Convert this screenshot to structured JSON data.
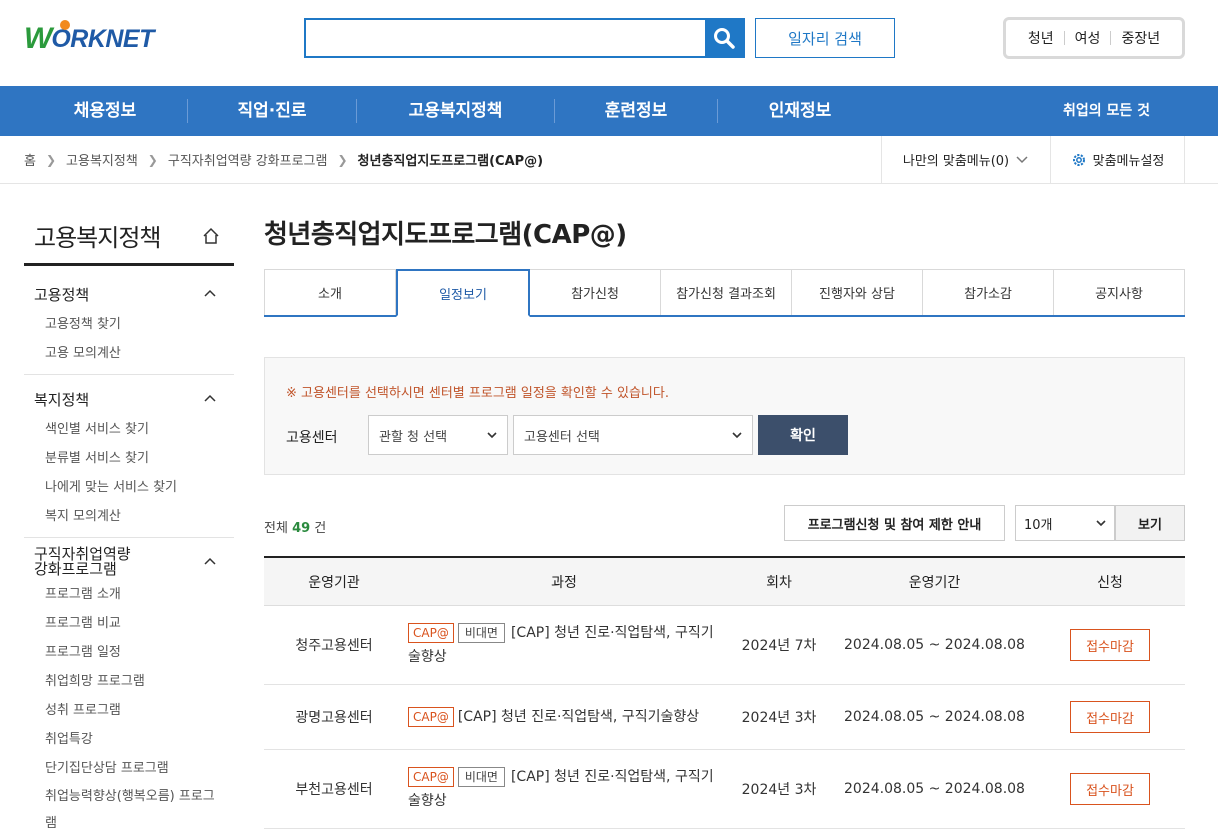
{
  "header": {
    "logo_text": "WORKNET",
    "search_placeholder": "",
    "job_search_label": "일자리 검색",
    "segments": [
      "청년",
      "여성",
      "중장년"
    ]
  },
  "gnb": {
    "items": [
      "채용정보",
      "직업·진로",
      "고용복지정책",
      "훈련정보",
      "인재정보"
    ],
    "all_label": "취업의 모든 것"
  },
  "breadcrumb": {
    "items": [
      "홈",
      "고용복지정책",
      "구직자취업역량 강화프로그램",
      "청년층직업지도프로그램(CAP@)"
    ],
    "my_menu": "나만의 맞춤메뉴(0)",
    "setting": "맞춤메뉴설정"
  },
  "sidebar": {
    "title": "고용복지정책",
    "groups": [
      {
        "title": "고용정책",
        "items": [
          "고용정책 찾기",
          "고용 모의계산"
        ]
      },
      {
        "title": "복지정책",
        "items": [
          "색인별 서비스 찾기",
          "분류별 서비스 찾기",
          "나에게 맞는 서비스 찾기",
          "복지 모의계산"
        ]
      },
      {
        "title_line1": "구직자취업역량",
        "title_line2": "강화프로그램",
        "items": [
          "프로그램 소개",
          "프로그램 비교",
          "프로그램 일정",
          "취업희망 프로그램",
          "성취 프로그램",
          "취업특강",
          "단기집단상담 프로그램",
          "취업능력향상(행복오름) 프로그",
          "램"
        ]
      }
    ]
  },
  "page": {
    "title": "청년층직업지도프로그램(CAP@)",
    "tabs": [
      "소개",
      "일정보기",
      "참가신청",
      "참가신청 결과조회",
      "진행자와 상담",
      "참가소감",
      "공지사항"
    ],
    "active_tab": 1
  },
  "filter": {
    "note": "※ 고용센터를 선택하시면 센터별 프로그램 일정을 확인할 수 있습니다.",
    "label": "고용센터",
    "select1": "관할 청 선택",
    "select2": "고용센터 선택",
    "confirm": "확인"
  },
  "toolbar": {
    "total_prefix": "전체",
    "total_count": "49",
    "total_suffix": "건",
    "restrict_label": "프로그램신청 및 참여 제한 안내",
    "count_select": "10개",
    "view_label": "보기"
  },
  "table": {
    "headers": [
      "운영기관",
      "과정",
      "회차",
      "운영기간",
      "신청"
    ],
    "rows": [
      {
        "org": "청주고용센터",
        "badge": "CAP@",
        "badge2": "비대면",
        "course": "[CAP] 청년 진로·직업탐색, 구직기술향상",
        "round": "2024년 7차",
        "period": "2024.08.05 ~ 2024.08.08",
        "apply": "접수마감"
      },
      {
        "org": "광명고용센터",
        "badge": "CAP@",
        "badge2": "",
        "course": "[CAP] 청년 진로·직업탐색, 구직기술향상",
        "round": "2024년 3차",
        "period": "2024.08.05 ~ 2024.08.08",
        "apply": "접수마감"
      },
      {
        "org": "부천고용센터",
        "badge": "CAP@",
        "badge2": "비대면",
        "course": "[CAP] 청년 진로·직업탐색, 구직기술향상",
        "round": "2024년 3차",
        "period": "2024.08.05 ~ 2024.08.08",
        "apply": "접수마감"
      }
    ]
  },
  "colors": {
    "primary": "#2f75c2",
    "accent": "#d9531e",
    "confirm": "#3c4f6b"
  }
}
